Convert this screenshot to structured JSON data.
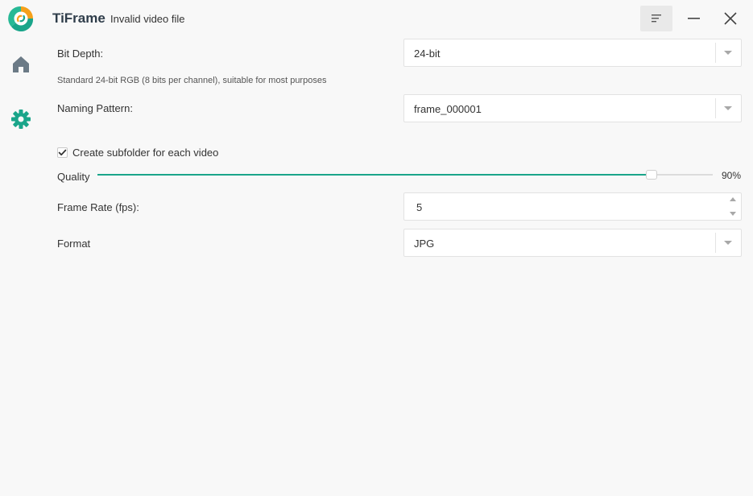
{
  "app": {
    "title": "TiFrame",
    "subtitle": "Invalid video file"
  },
  "sidebar": {
    "items": [
      {
        "icon": "home-icon",
        "active": false
      },
      {
        "icon": "gear-icon",
        "active": true
      }
    ],
    "accent": "#1aa58a",
    "inactive_color": "#6b7a86"
  },
  "settings": {
    "bit_depth": {
      "label": "Bit Depth:",
      "value": "24-bit",
      "hint": "Standard 24-bit RGB (8 bits per channel), suitable for most purposes"
    },
    "naming_pattern": {
      "label": "Naming Pattern:",
      "value": "frame_000001"
    },
    "subfolder": {
      "label": "Create subfolder for each video",
      "checked": true
    },
    "quality": {
      "label": "Quality",
      "percent": 90,
      "value_text": "90%"
    },
    "frame_rate": {
      "label": "Frame Rate (fps):",
      "value": "5"
    },
    "format": {
      "label": "Format",
      "value": "JPG"
    }
  }
}
